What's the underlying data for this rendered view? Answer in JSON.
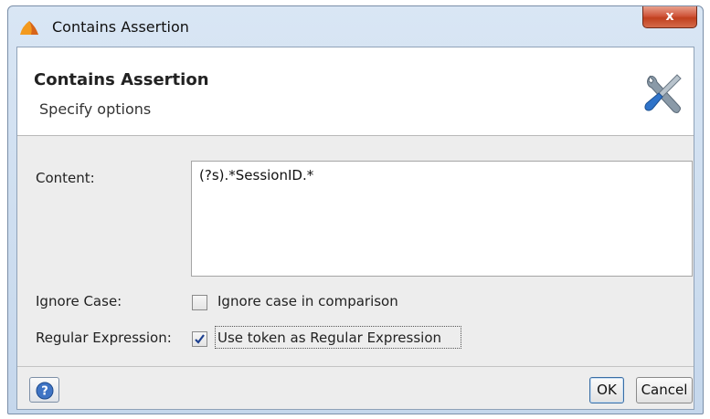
{
  "window": {
    "title": "Contains Assertion",
    "close_label": "x"
  },
  "header": {
    "title": "Contains Assertion",
    "subtitle": "Specify options",
    "icon": "tools-icon"
  },
  "form": {
    "content_label": "Content:",
    "content_value": "(?s).*SessionID.*",
    "ignore_case_label": "Ignore Case:",
    "ignore_case_checkbox_label": "Ignore case in comparison",
    "ignore_case_checked": false,
    "regex_label": "Regular Expression:",
    "regex_checkbox_label": "Use token as Regular Expression",
    "regex_checked": true
  },
  "footer": {
    "help_icon": "help-icon",
    "ok_label": "OK",
    "cancel_label": "Cancel"
  },
  "colors": {
    "title_gradient_top": "#d9e6f4",
    "close_button": "#c1401f",
    "panel_bg": "#ededed",
    "checkmark": "#1c3f8f"
  }
}
